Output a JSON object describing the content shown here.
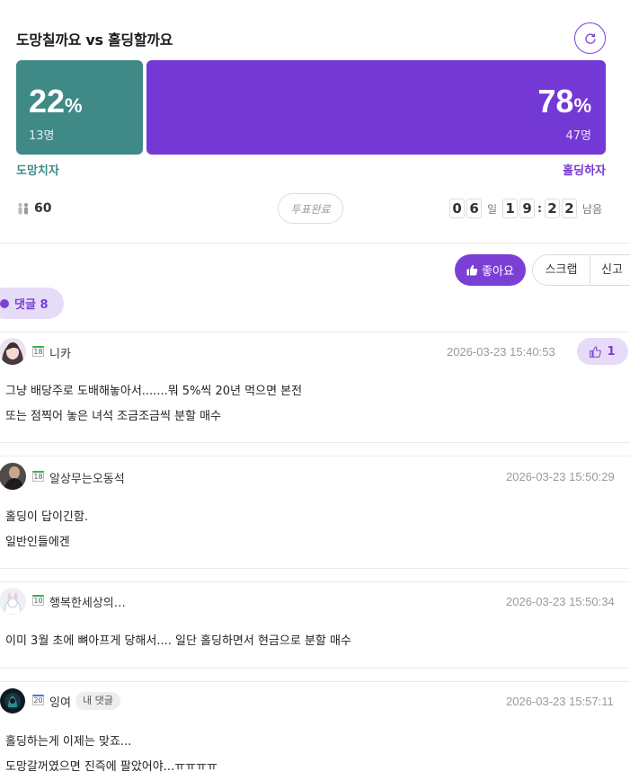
{
  "poll": {
    "title": "도망칠까요 vs 홀딩할까요",
    "option_a": {
      "label": "도망치자",
      "percent": "22",
      "percent_sign": "%",
      "count": "13명",
      "color": "#3f8a87"
    },
    "option_b": {
      "label": "홀딩하자",
      "percent": "78",
      "percent_sign": "%",
      "count": "47명",
      "color": "#7438d4"
    },
    "voters": "60",
    "status": "투표완료",
    "timer": {
      "d1": "0",
      "d2": "6",
      "day_unit": "일",
      "h1": "1",
      "h2": "9",
      "colon": ":",
      "m1": "2",
      "m2": "2",
      "suffix": "남음"
    }
  },
  "actions": {
    "like": "좋아요",
    "scrap": "스크랩",
    "report": "신고"
  },
  "comments_header": {
    "label": "댓글 8"
  },
  "comments": [
    {
      "level": "18",
      "name": "니카",
      "date": "2026-03-23 15:40:53",
      "likes": "1",
      "lines": [
        "그냥 배당주로 도배해놓아서.......뭐 5%씩 20년 먹으면 본전",
        "또는 점찍어 놓은 녀석 조금조금씩 분할 매수"
      ]
    },
    {
      "level": "18",
      "name": "알상무는오동석",
      "date": "2026-03-23 15:50:29",
      "lines": [
        "홀딩이 답이긴함.",
        "일반인들에겐"
      ]
    },
    {
      "level": "10",
      "name": "행복한세상의…",
      "date": "2026-03-23 15:50:34",
      "lines": [
        "이미 3월 초에 뼈아프게 당해서.... 일단 홀딩하면서 현금으로 분할 매수"
      ]
    },
    {
      "level": "20",
      "name": "잉여",
      "badge": "내 댓글",
      "date": "2026-03-23 15:57:11",
      "lines": [
        "홀딩하는게 이제는 맞죠...",
        "도망갈꺼였으면 진즉에 팔았어야...ㅠㅠㅠㅠ"
      ]
    }
  ],
  "colors": {
    "accent": "#7b3fd6",
    "teal": "#3f8a87",
    "purple": "#7438d4",
    "light_purple": "#e6dcf7"
  }
}
